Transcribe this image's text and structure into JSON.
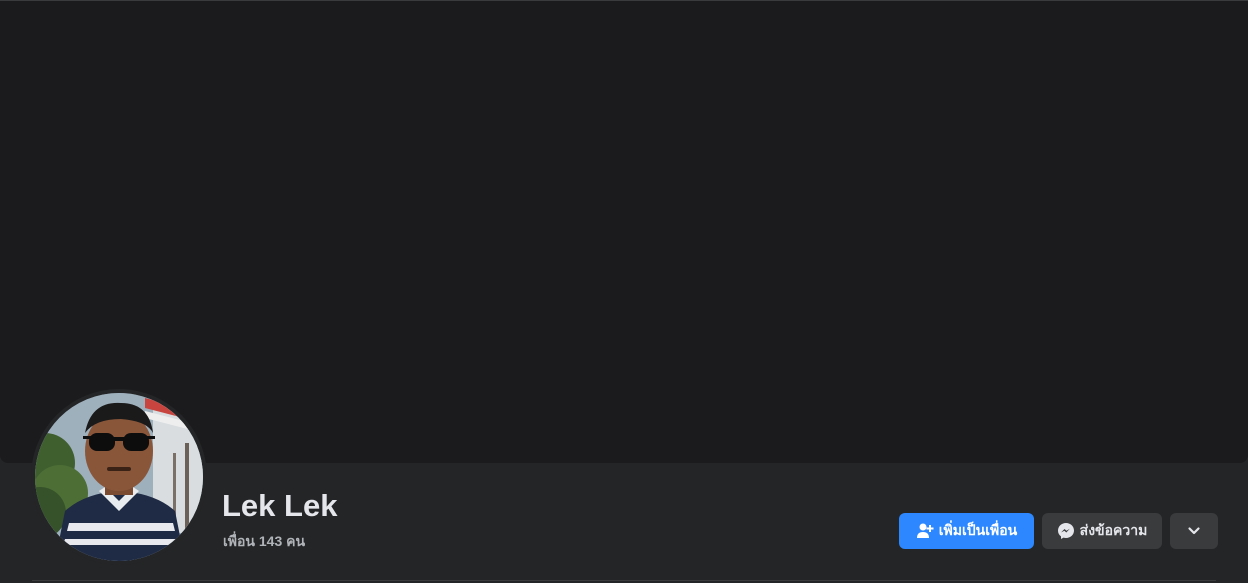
{
  "profile": {
    "name": "Lek Lek",
    "friends_count": "เพื่อน 143 คน",
    "avatar_icon": "profile-photo"
  },
  "actions": {
    "add_friend_label": "เพิ่มเป็นเพื่อน",
    "add_friend_icon": "add-person-icon",
    "message_label": "ส่งข้อความ",
    "message_icon": "messenger-icon",
    "more_icon": "chevron-down-icon"
  },
  "colors": {
    "background": "#242526",
    "cover": "#1b1b1d",
    "primary_button": "#2d88ff",
    "secondary_button": "#3a3b3c",
    "text_primary": "#e4e6eb",
    "text_secondary": "#b0b3b8"
  }
}
